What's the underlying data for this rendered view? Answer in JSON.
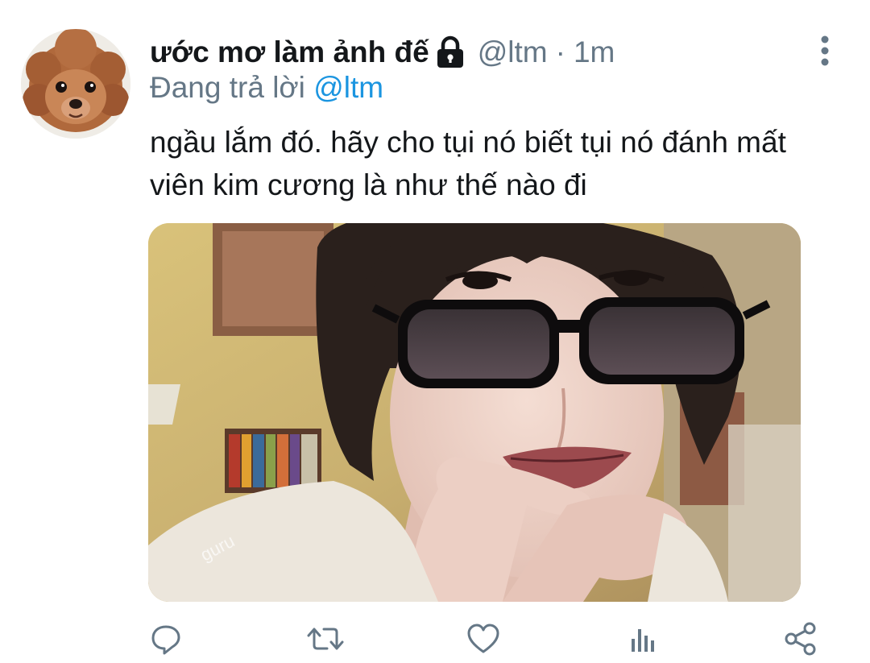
{
  "tweet": {
    "display_name": "ước mơ làm ảnh đế",
    "handle": "@ltm",
    "separator": "·",
    "time": "1m",
    "reply_prefix": "Đang trả lời",
    "reply_to": "@ltm",
    "text": "ngầu lắm đó. hãy cho tụi nó biết tụi nó đánh mất viên kim cương là như thế nào đi",
    "media_watermark": "guru"
  },
  "icons": {
    "avatar": "dog-avatar",
    "protected": "lock-icon",
    "more": "more-vertical-icon",
    "reply": "reply-icon",
    "retweet": "retweet-icon",
    "like": "heart-icon",
    "analytics": "analytics-icon",
    "share": "share-icon"
  },
  "colors": {
    "text": "#14171a",
    "secondary": "#657786",
    "link": "#1b95e0"
  }
}
